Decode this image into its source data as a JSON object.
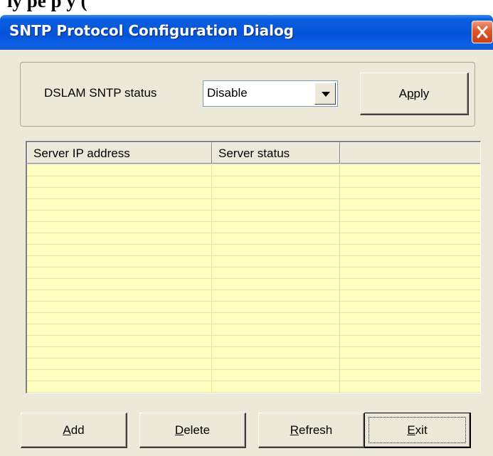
{
  "document_text": "ly     pe          p      y        (",
  "window": {
    "title": "SNTP Protocol Configuration Dialog"
  },
  "sntp": {
    "status_label": "DSLAM SNTP status",
    "selected_value": "Disable",
    "apply_label": [
      "A",
      "p",
      "ply"
    ]
  },
  "table": {
    "columns": [
      "Server IP address",
      "Server status",
      ""
    ],
    "rows": []
  },
  "buttons": {
    "add": [
      "A",
      "dd"
    ],
    "delete": [
      "D",
      "elete"
    ],
    "refresh": [
      "R",
      "efresh"
    ],
    "exit": [
      "E",
      "xit"
    ]
  },
  "colors": {
    "title_bar": "#0553d8",
    "dialog_face": "#ece9d8",
    "list_background": "#ffffc0",
    "close_button": "#e0552a"
  },
  "icons": {
    "close": "close-x-icon",
    "dropdown": "chevron-down-icon"
  }
}
